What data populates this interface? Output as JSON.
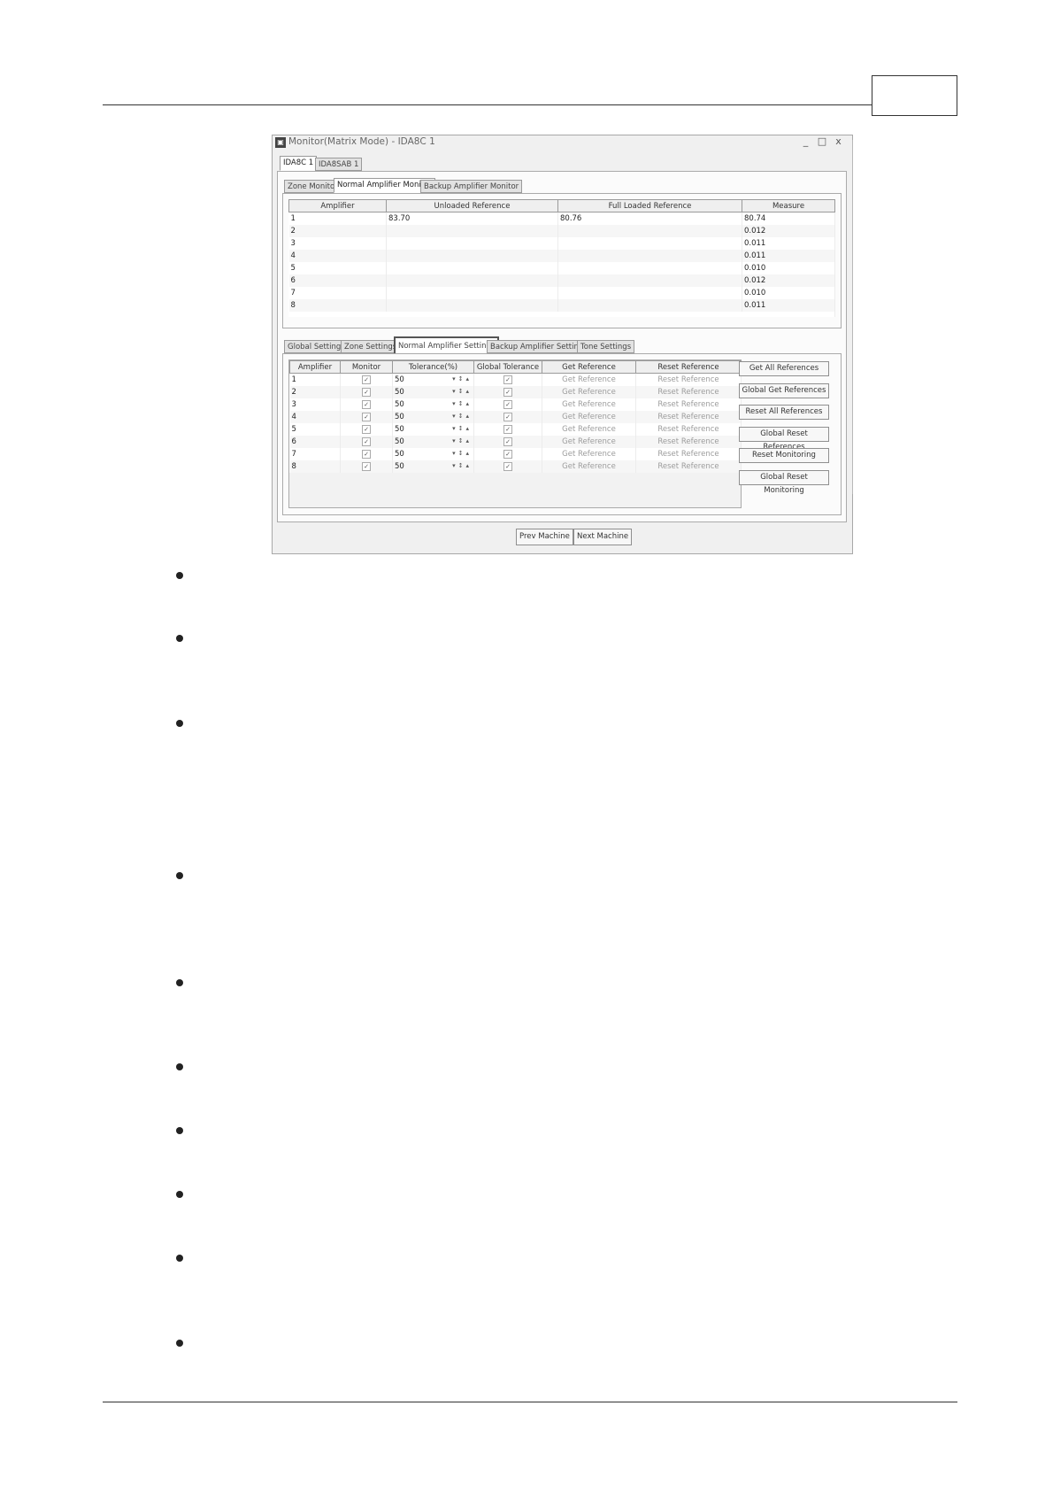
{
  "window": {
    "title": "Monitor(Matrix Mode) - IDA8C 1",
    "controls": [
      "_",
      "□",
      "x"
    ]
  },
  "machine_tabs": [
    "IDA8C 1",
    "IDA8SAB 1"
  ],
  "monitor_tabs": [
    "Zone Monitor",
    "Normal Amplifier Monitor",
    "Backup Amplifier Monitor"
  ],
  "monitor_table": {
    "headers": [
      "Amplifier",
      "Unloaded Reference",
      "Full Loaded Reference",
      "Measure"
    ],
    "rows": [
      [
        "1",
        "83.70",
        "80.76",
        "80.74"
      ],
      [
        "2",
        "",
        "",
        "0.012"
      ],
      [
        "3",
        "",
        "",
        "0.011"
      ],
      [
        "4",
        "",
        "",
        "0.011"
      ],
      [
        "5",
        "",
        "",
        "0.010"
      ],
      [
        "6",
        "",
        "",
        "0.012"
      ],
      [
        "7",
        "",
        "",
        "0.010"
      ],
      [
        "8",
        "",
        "",
        "0.011"
      ]
    ]
  },
  "settings_tabs": [
    "Global Settings",
    "Zone Settings",
    "Normal Amplifier Settings",
    "Backup Amplifier Settings",
    "Tone Settings"
  ],
  "settings_table": {
    "headers": [
      "Amplifier",
      "Monitor",
      "Tolerance(%)",
      "Global Tolerance",
      "Get Reference",
      "Reset Reference"
    ],
    "check_mark": "✓",
    "rows": [
      {
        "amp": "1",
        "tolerance": "50",
        "get": "Get Reference",
        "reset": "Reset Reference"
      },
      {
        "amp": "2",
        "tolerance": "50",
        "get": "Get Reference",
        "reset": "Reset Reference"
      },
      {
        "amp": "3",
        "tolerance": "50",
        "get": "Get Reference",
        "reset": "Reset Reference"
      },
      {
        "amp": "4",
        "tolerance": "50",
        "get": "Get Reference",
        "reset": "Reset Reference"
      },
      {
        "amp": "5",
        "tolerance": "50",
        "get": "Get Reference",
        "reset": "Reset Reference"
      },
      {
        "amp": "6",
        "tolerance": "50",
        "get": "Get Reference",
        "reset": "Reset Reference"
      },
      {
        "amp": "7",
        "tolerance": "50",
        "get": "Get Reference",
        "reset": "Reset Reference"
      },
      {
        "amp": "8",
        "tolerance": "50",
        "get": "Get Reference",
        "reset": "Reset Reference"
      }
    ]
  },
  "side_buttons": [
    "Get All References",
    "Global Get References",
    "Reset All References",
    "Global Reset References",
    "Reset Monitoring",
    "Global Reset Monitoring"
  ],
  "nav_buttons": {
    "prev": "Prev Machine",
    "next": "Next Machine"
  }
}
